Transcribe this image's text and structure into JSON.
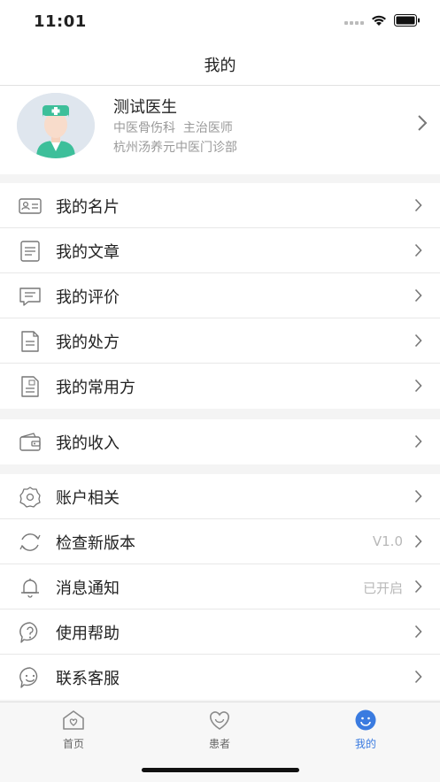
{
  "status": {
    "time": "11:01"
  },
  "nav": {
    "title": "我的"
  },
  "profile": {
    "name": "测试医生",
    "department_title": "中医骨伤科  主治医师",
    "clinic": "杭州汤养元中医门诊部"
  },
  "group1": [
    {
      "label": "我的名片",
      "icon": "id-card-icon"
    },
    {
      "label": "我的文章",
      "icon": "article-icon"
    },
    {
      "label": "我的评价",
      "icon": "comment-icon"
    },
    {
      "label": "我的处方",
      "icon": "prescription-icon"
    },
    {
      "label": "我的常用方",
      "icon": "common-prescription-icon"
    }
  ],
  "group2": [
    {
      "label": "我的收入",
      "icon": "wallet-icon"
    }
  ],
  "group3": [
    {
      "label": "账户相关",
      "icon": "gear-icon",
      "value": ""
    },
    {
      "label": "检查新版本",
      "icon": "refresh-icon",
      "value": "V1.0"
    },
    {
      "label": "消息通知",
      "icon": "bell-icon",
      "value": "已开启"
    },
    {
      "label": "使用帮助",
      "icon": "help-icon",
      "value": ""
    },
    {
      "label": "联系客服",
      "icon": "support-icon",
      "value": ""
    }
  ],
  "tabs": [
    {
      "label": "首页",
      "icon": "home-icon"
    },
    {
      "label": "患者",
      "icon": "patient-icon"
    },
    {
      "label": "我的",
      "icon": "profile-smile-icon"
    }
  ],
  "colors": {
    "accent": "#3a7be0",
    "icon_gray": "#777777"
  }
}
